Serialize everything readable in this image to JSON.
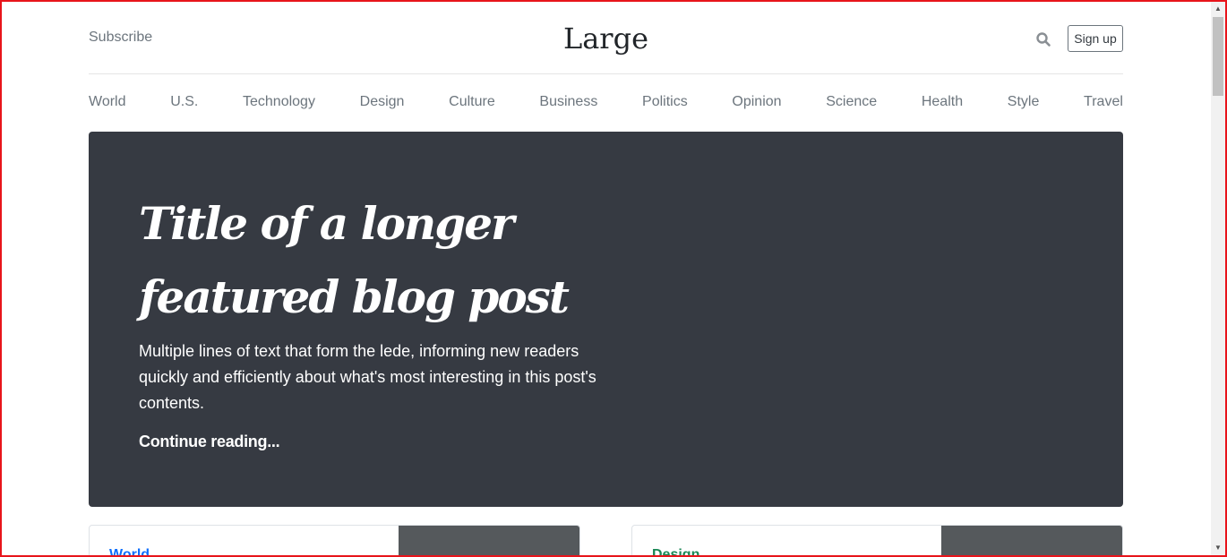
{
  "header": {
    "subscribe_label": "Subscribe",
    "logo_text": "Large",
    "signup_label": "Sign up",
    "search_icon": "search-icon"
  },
  "nav": {
    "items": [
      "World",
      "U.S.",
      "Technology",
      "Design",
      "Culture",
      "Business",
      "Politics",
      "Opinion",
      "Science",
      "Health",
      "Style",
      "Travel"
    ]
  },
  "hero": {
    "title": "Title of a longer featured blog post",
    "lede": "Multiple lines of text that form the lede, informing new readers quickly and efficiently about what's most interesting in this post's contents.",
    "link_label": "Continue reading..."
  },
  "cards": [
    {
      "category": "World",
      "color": "#0d6efd"
    },
    {
      "category": "Design",
      "color": "#198754"
    }
  ],
  "colors": {
    "hero_bg": "#363a42",
    "frame": "#e8141b",
    "muted_text": "#6c757d"
  }
}
